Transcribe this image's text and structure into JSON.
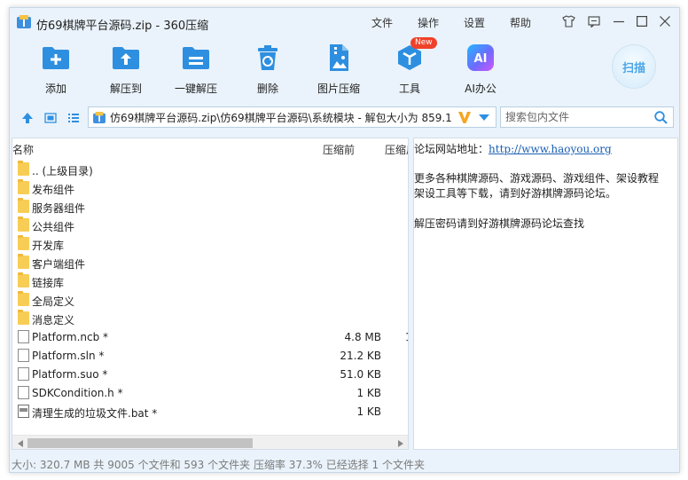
{
  "titlebar": {
    "title": "仿69棋牌平台源码.zip - 360压缩",
    "menu": [
      "文件",
      "操作",
      "设置",
      "帮助"
    ]
  },
  "toolbar": {
    "items": [
      {
        "label": "添加",
        "icon": "add-folder-icon"
      },
      {
        "label": "解压到",
        "icon": "extract-to-icon"
      },
      {
        "label": "一键解压",
        "icon": "one-click-extract-icon"
      },
      {
        "label": "删除",
        "icon": "trash-icon"
      },
      {
        "label": "图片压缩",
        "icon": "image-compress-icon"
      },
      {
        "label": "工具",
        "icon": "tools-icon"
      },
      {
        "label": "AI办公",
        "icon": "ai-icon"
      }
    ],
    "new_badge": "New",
    "ai_icon_text": "AI",
    "scan_label": "扫描"
  },
  "address": {
    "path": "仿69棋牌平台源码.zip\\仿69棋牌平台源码\\系统模块 - 解包大小为 859.1"
  },
  "search": {
    "placeholder": "搜索包内文件"
  },
  "columns": {
    "name": "名称",
    "size": "压缩前",
    "packed": "压缩后"
  },
  "files": [
    {
      "name": ".. (上级目录)",
      "type": "folder",
      "size": "",
      "packed": ""
    },
    {
      "name": "发布组件",
      "type": "folder",
      "size": "",
      "packed": ""
    },
    {
      "name": "服务器组件",
      "type": "folder",
      "size": "",
      "packed": ""
    },
    {
      "name": "公共组件",
      "type": "folder",
      "size": "",
      "packed": ""
    },
    {
      "name": "开发库",
      "type": "folder",
      "size": "",
      "packed": ""
    },
    {
      "name": "客户端组件",
      "type": "folder",
      "size": "",
      "packed": ""
    },
    {
      "name": "链接库",
      "type": "folder",
      "size": "",
      "packed": ""
    },
    {
      "name": "全局定义",
      "type": "folder",
      "size": "",
      "packed": ""
    },
    {
      "name": "消息定义",
      "type": "folder",
      "size": "",
      "packed": ""
    },
    {
      "name": "Platform.ncb *",
      "type": "file",
      "size": "4.8 MB",
      "packed": "1"
    },
    {
      "name": "Platform.sln *",
      "type": "file",
      "size": "21.2 KB",
      "packed": ""
    },
    {
      "name": "Platform.suo *",
      "type": "file",
      "size": "51.0 KB",
      "packed": ""
    },
    {
      "name": "SDKCondition.h *",
      "type": "file",
      "size": "1 KB",
      "packed": ""
    },
    {
      "name": "清理生成的垃圾文件.bat *",
      "type": "bat",
      "size": "1 KB",
      "packed": ""
    }
  ],
  "comment": {
    "site_label": "论坛网站地址：",
    "site_url": "http://www.haoyou.org",
    "line2": "更多各种棋牌源码、游戏源码、游戏组件、架设教程",
    "line3": "架设工具等下载，请到好游棋牌源码论坛。",
    "line4": "解压密码请到好游棋牌源码论坛查找"
  },
  "status": {
    "text": "大小: 320.7 MB 共 9005 个文件和 593 个文件夹 压缩率 37.3% 已经选择 1 个文件夹"
  },
  "colors": {
    "window_bg": "#eaf3fb",
    "accent_blue": "#2e8fe0",
    "folder": "#f8cd56",
    "badge_red": "#f0412a",
    "link": "#1a5fb4"
  }
}
